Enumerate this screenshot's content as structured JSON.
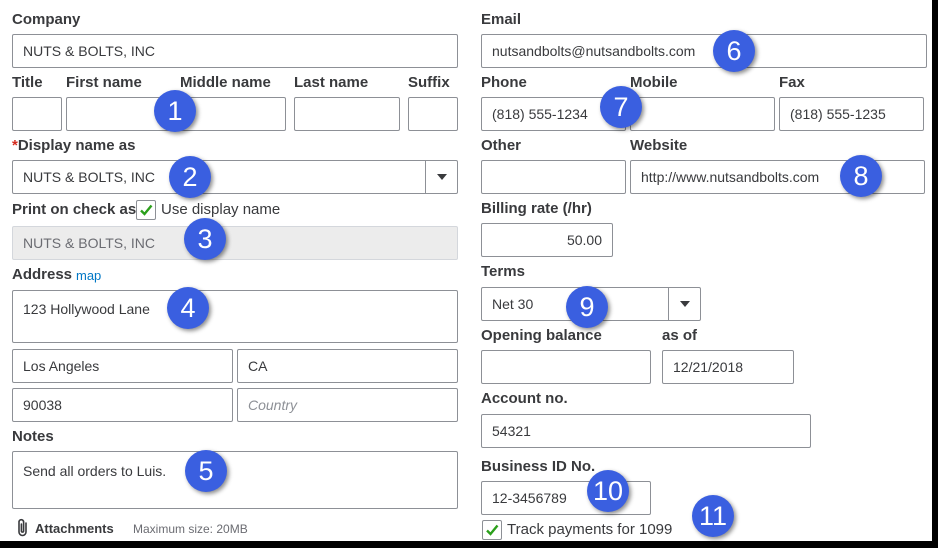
{
  "form": {
    "company": {
      "label": "Company",
      "value": "NUTS & BOLTS, INC"
    },
    "name": {
      "title_label": "Title",
      "first_label": "First name",
      "middle_label": "Middle name",
      "last_label": "Last name",
      "suffix_label": "Suffix",
      "title": "",
      "first": "",
      "middle": "",
      "last": "",
      "suffix": ""
    },
    "display_name": {
      "required_mark": "*",
      "label": "Display name as",
      "value": "NUTS & BOLTS, INC"
    },
    "print_on_check": {
      "label": "Print on check as",
      "checkbox_label": "Use display name",
      "checked": true,
      "value": "NUTS & BOLTS, INC"
    },
    "address": {
      "label": "Address",
      "map_link": "map",
      "street": "123 Hollywood Lane",
      "city": "Los Angeles",
      "state": "CA",
      "zip": "90038",
      "country_placeholder": "Country"
    },
    "notes": {
      "label": "Notes",
      "value": "Send all orders to Luis."
    },
    "attachments": {
      "label": "Attachments",
      "max_size": "Maximum size: 20MB"
    },
    "email": {
      "label": "Email",
      "value": "nutsandbolts@nutsandbolts.com"
    },
    "phone": {
      "label": "Phone",
      "value": "(818) 555-1234"
    },
    "mobile": {
      "label": "Mobile",
      "value": ""
    },
    "fax": {
      "label": "Fax",
      "value": "(818) 555-1235"
    },
    "other": {
      "label": "Other",
      "value": ""
    },
    "website": {
      "label": "Website",
      "value": "http://www.nutsandbolts.com"
    },
    "billing_rate": {
      "label": "Billing rate (/hr)",
      "value": "50.00"
    },
    "terms": {
      "label": "Terms",
      "value": "Net 30"
    },
    "opening_balance": {
      "label": "Opening balance",
      "value": "",
      "as_of_label": "as of",
      "as_of": "12/21/2018"
    },
    "account_no": {
      "label": "Account no.",
      "value": "54321"
    },
    "business_id": {
      "label": "Business ID No.",
      "value": "12-3456789"
    },
    "track_1099": {
      "label": "Track payments for 1099",
      "checked": true
    }
  },
  "callouts": [
    "1",
    "2",
    "3",
    "4",
    "5",
    "6",
    "7",
    "8",
    "9",
    "10",
    "11"
  ],
  "colors": {
    "callout": "#3a5fe0",
    "check": "#2ca01c",
    "link": "#0077c5",
    "required": "#d52b1e"
  }
}
